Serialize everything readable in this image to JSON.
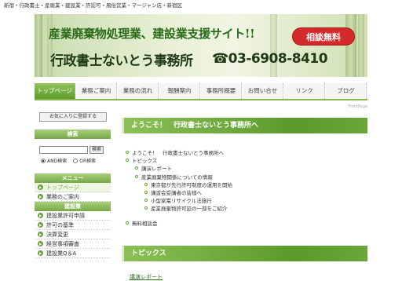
{
  "top_line": "新宿・行政書士・産廃業・建設業・許認可・風俗営業・マージャン店・新宿区",
  "banner": {
    "catchphrase": "産業廃棄物処理業、建設業支援サイト!!",
    "office_name": "行政書士ないとう事務所",
    "phone": "☎03-6908-8410",
    "consult_badge": "相談無料"
  },
  "nav": {
    "items": [
      "トップページ",
      "業務ご案内",
      "業務の流れ",
      "報酬案内",
      "事務所概要",
      "お問い合せ",
      "リンク",
      "ブログ"
    ]
  },
  "sidebar": {
    "favorites_button": "お気に入りに登録する",
    "search": {
      "heading": "検索",
      "button": "検索",
      "radio_and": "AND検索",
      "radio_or": "OR検索",
      "selected": "AND検索"
    },
    "menu": {
      "heading": "メニュー",
      "items": [
        "トップページ",
        "業務のご案内"
      ],
      "current": "トップページ"
    },
    "construction": {
      "heading": "建設業",
      "items": [
        "建設業許可申請",
        "許可の基準",
        "決算変更",
        "経営事項審査",
        "建設業Q＆A"
      ]
    }
  },
  "main": {
    "frontpage_label": "FrontPage",
    "welcome_heading": "ようこそ！　行政書士ないとう事務所へ",
    "toc": [
      {
        "level": 1,
        "text": "ようこそ！　行政書士ないとう事務所へ"
      },
      {
        "level": 1,
        "text": "トピックス"
      },
      {
        "level": 2,
        "text": "講演レポート"
      },
      {
        "level": 2,
        "text": "産業廃棄物関係についての情報"
      },
      {
        "level": 3,
        "text": "東京都が先行許可制度の運用を開始"
      },
      {
        "level": 3,
        "text": "講習会受講者の皆様へ"
      },
      {
        "level": 3,
        "text": "小型家電リサイクル法施行"
      },
      {
        "level": 3,
        "text": "産業廃棄物許可証の一部をご紹介"
      },
      {
        "level": 1,
        "text": "無料相談会"
      }
    ],
    "topics_heading": "トピックス",
    "section_link": "講演レポート"
  }
}
